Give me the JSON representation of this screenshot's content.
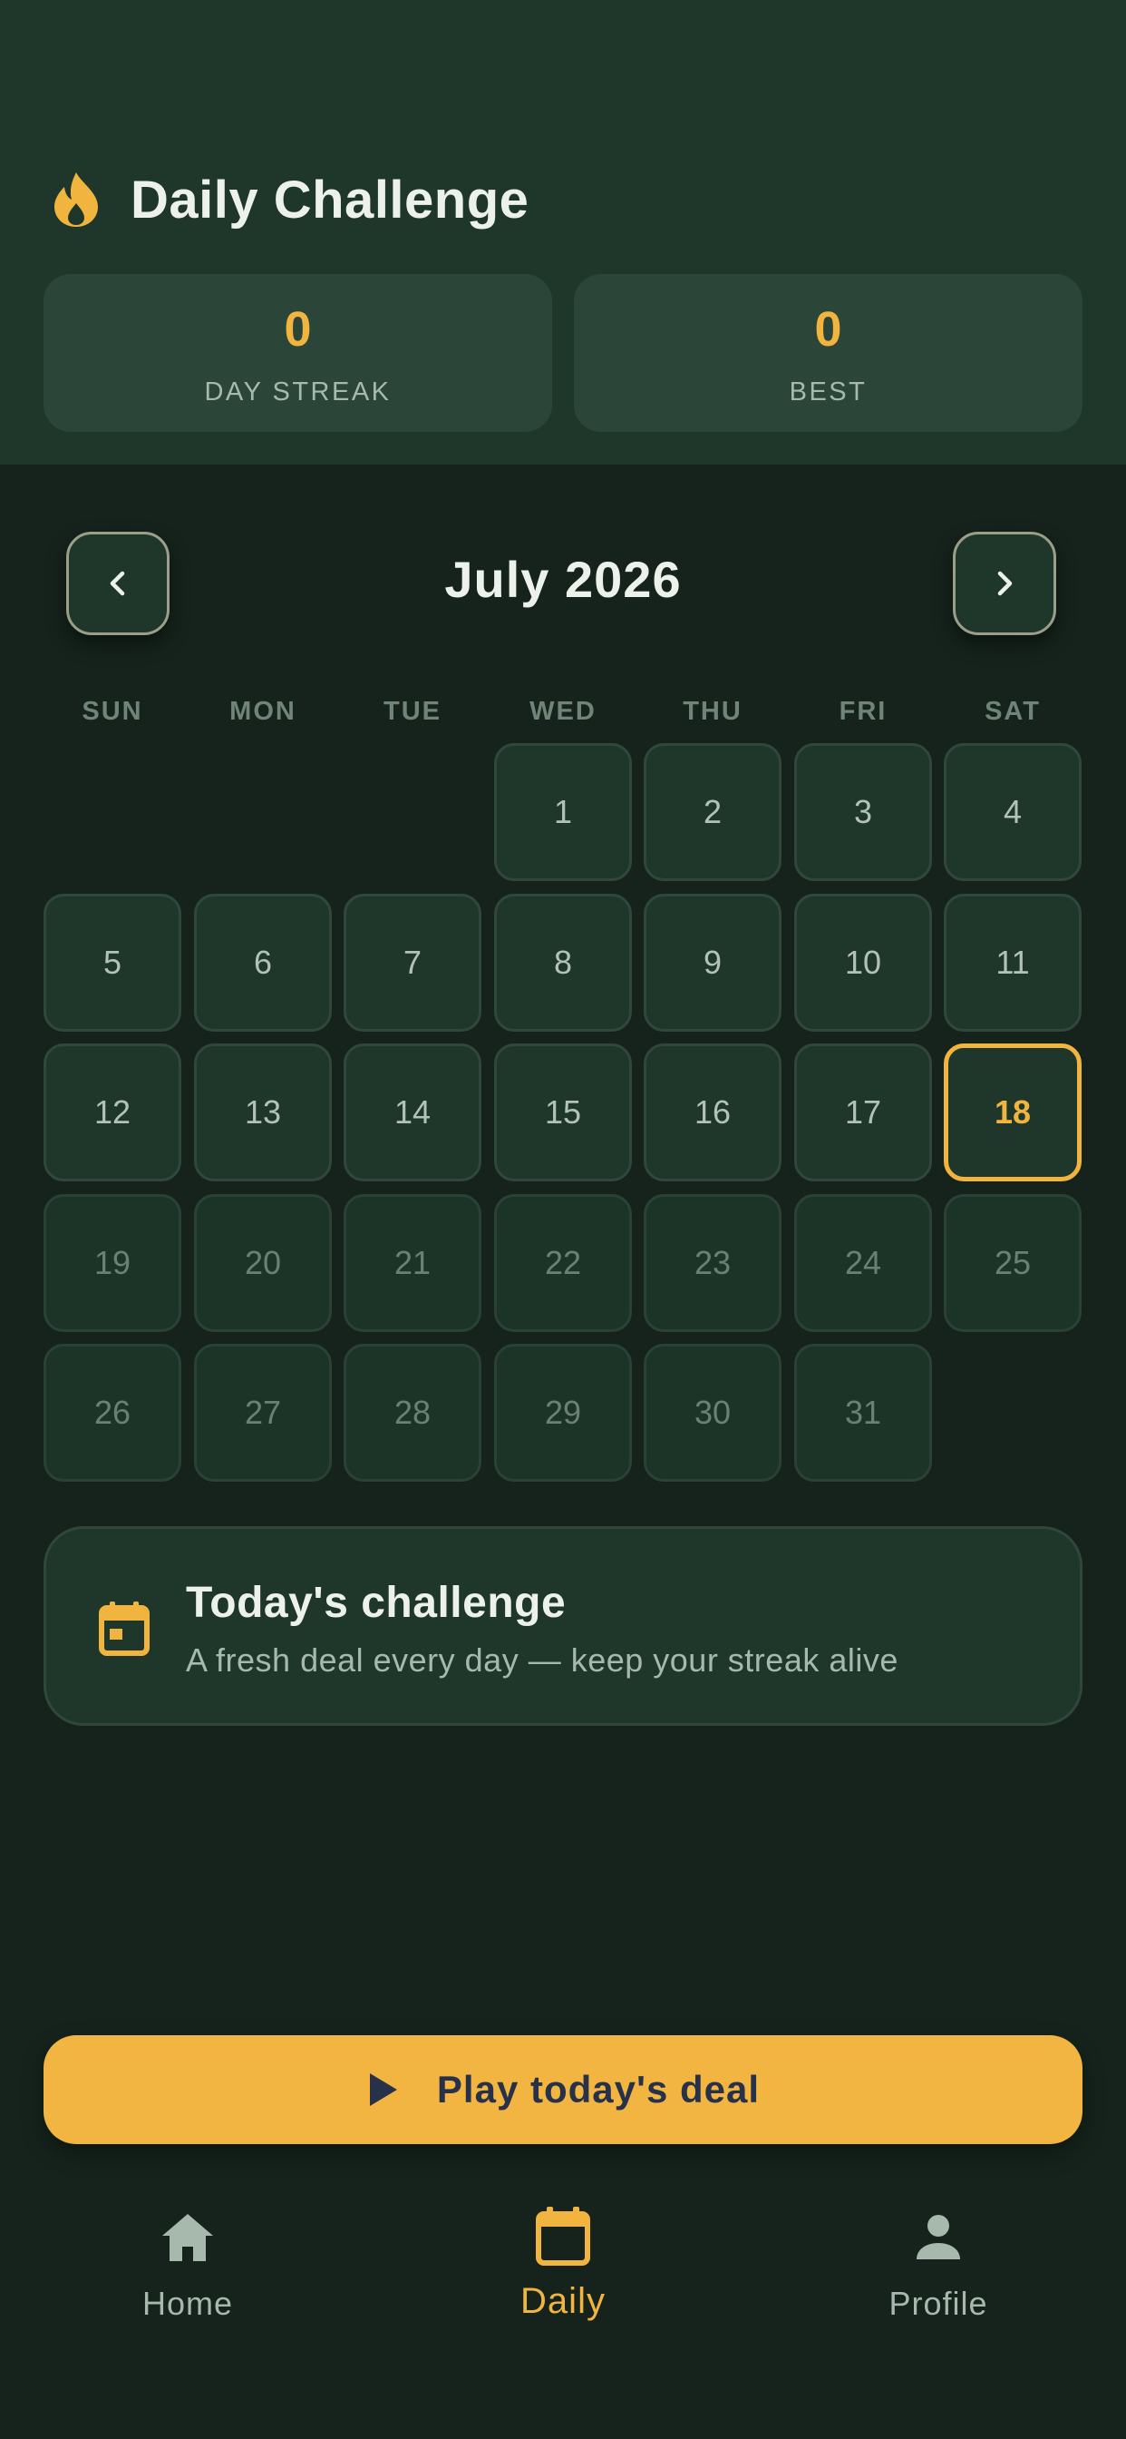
{
  "header": {
    "title": "Daily Challenge",
    "title_icon": "flame-icon",
    "accent_color": "#f1b53f"
  },
  "stats": {
    "streak": {
      "value": "0",
      "label": "DAY STREAK"
    },
    "best": {
      "value": "0",
      "label": "BEST"
    }
  },
  "calendar": {
    "month_title": "July 2026",
    "prev_icon": "chevron-left-icon",
    "next_icon": "chevron-right-icon",
    "weekdays": [
      "SUN",
      "MON",
      "TUE",
      "WED",
      "THU",
      "FRI",
      "SAT"
    ],
    "days": [
      "1",
      "2",
      "3",
      "4",
      "5",
      "6",
      "7",
      "8",
      "9",
      "10",
      "11",
      "12",
      "13",
      "14",
      "15",
      "16",
      "17",
      "18",
      "19",
      "20",
      "21",
      "22",
      "23",
      "24",
      "25",
      "26",
      "27",
      "28",
      "29",
      "30",
      "31"
    ],
    "today": "18"
  },
  "challenge": {
    "icon": "calendar-icon",
    "title": "Today's challenge",
    "subtitle": "A fresh deal every day — keep your streak alive"
  },
  "play_button": {
    "icon": "play-icon",
    "label": "Play today's deal"
  },
  "tabbar": {
    "home": {
      "label": "Home",
      "icon": "home-icon"
    },
    "daily": {
      "label": "Daily",
      "icon": "calendar-icon"
    },
    "profile": {
      "label": "Profile",
      "icon": "person-icon"
    }
  }
}
